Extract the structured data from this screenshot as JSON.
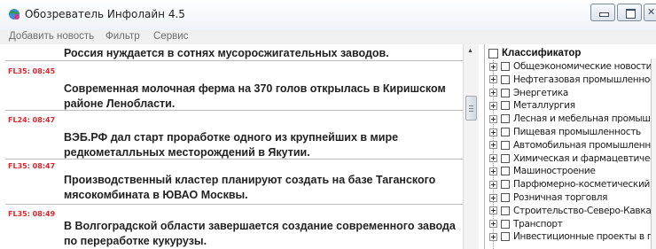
{
  "window": {
    "title": "Обозреватель Инфолайн 4.5",
    "icon": "app-globe-icon"
  },
  "menu": {
    "items": [
      "Добавить новость",
      "Фильтр",
      "Сервис"
    ]
  },
  "news": {
    "items": [
      {
        "tag": "",
        "headline": "Россия нуждается в сотнях мусоросжигательных заводов."
      },
      {
        "tag": "FL35: 08:45",
        "headline": "Современная молочная ферма на 370 голов открылась в Киришском районе Ленобласти."
      },
      {
        "tag": "FL24: 08:47",
        "headline": "ВЭБ.РФ дал старт проработке одного из крупнейших в мире редкометалльных месторождений в Якутии."
      },
      {
        "tag": "FL35: 08:47",
        "headline": "Производственный кластер планируют создать на базе Таганского мясокомбината в ЮВАО Москвы."
      },
      {
        "tag": "FL35: 08:49",
        "headline": "В Волгоградской области завершается создание современного завода по переработке кукурузы."
      }
    ]
  },
  "classifier": {
    "root_label": "Классификатор",
    "items": [
      "Общеэкономические новости",
      "Нефтегазовая промышленность",
      "Энергетика",
      "Металлургия",
      "Лесная и мебельная промышлен",
      "Пищевая промышленность",
      "Автомобильная промышленност",
      "Химическая и фармацевтическа",
      "Машиностроение",
      "Парфюмерно-косметический ры",
      "Розничная торговля",
      "Строительство-Северо-Кавказск",
      "Транспорт",
      "Инвестиционные проекты в прог"
    ]
  }
}
